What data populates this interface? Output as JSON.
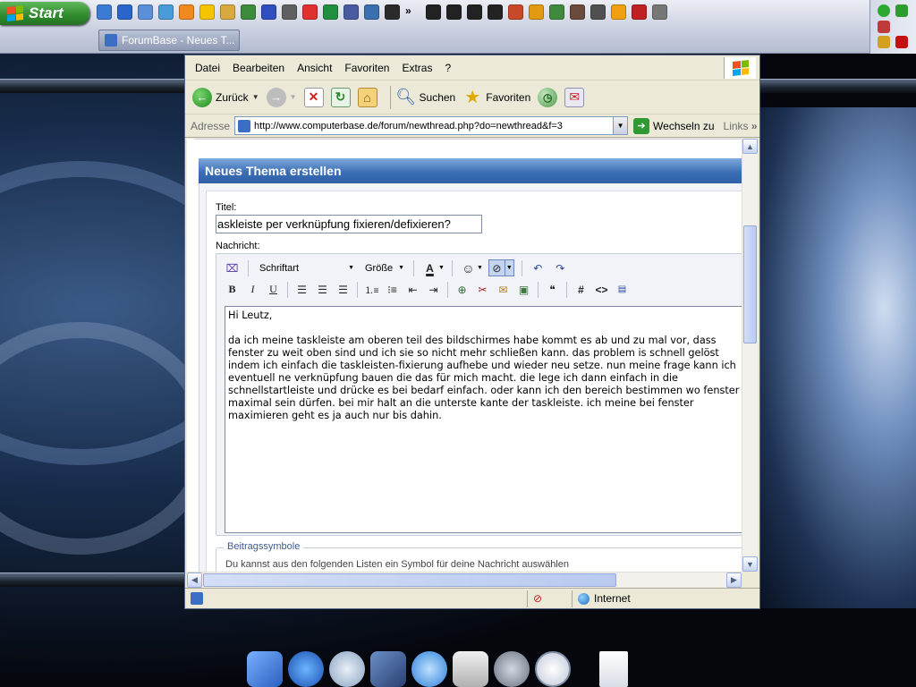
{
  "taskbar": {
    "start_label": "Start",
    "task_title": "ForumBase - Neues T..."
  },
  "browser": {
    "menu": [
      "Datei",
      "Bearbeiten",
      "Ansicht",
      "Favoriten",
      "Extras",
      "?"
    ],
    "toolbar": {
      "back": "Zurück",
      "search": "Suchen",
      "favorites": "Favoriten"
    },
    "address_label": "Adresse",
    "address_url": "http://www.computerbase.de/forum/newthread.php?do=newthread&f=3",
    "go_label": "Wechseln zu",
    "links_label": "Links",
    "status_zone": "Internet"
  },
  "page": {
    "section_title": "Neues Thema erstellen",
    "title_label": "Titel:",
    "title_value": "askleiste per verknüpfung fixieren/defixieren?",
    "message_label": "Nachricht:",
    "font_select": "Schriftart",
    "size_select": "Größe",
    "message_body": "Hi Leutz,\n\nda ich meine taskleiste am oberen teil des bildschirmes habe kommt es ab und zu mal vor, dass fenster zu weit oben sind und ich sie so nicht mehr schließen kann. das problem is schnell gelöst indem ich einfach die taskleisten-fixierung aufhebe und wieder neu setze. nun meine frage kann ich eventuell ne verknüpfung bauen die das für mich macht. die lege ich dann einfach in die schnellstartleiste und drücke es bei bedarf einfach. oder kann ich den bereich bestimmen wo fenster maximal sein dürfen. bei mir halt an die unterste kante der taskleiste. ich meine bei fenster maximieren geht es ja auch nur bis dahin.",
    "post_icons_legend": "Beitragssymbole",
    "post_icons_text": "Du kannst aus den folgenden Listen ein Symbol für deine Nachricht auswählen"
  }
}
